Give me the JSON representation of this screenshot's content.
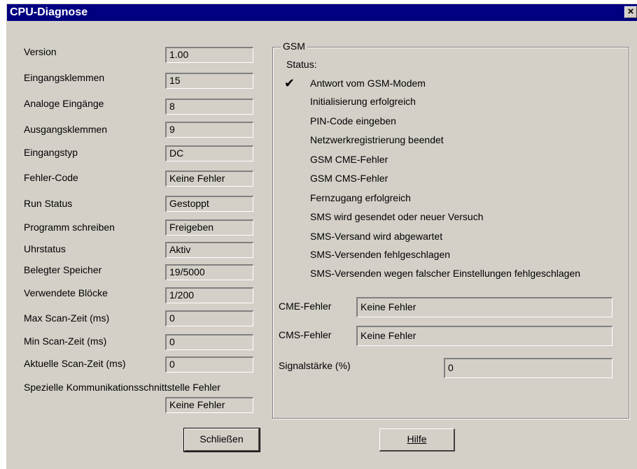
{
  "window": {
    "title": "CPU-Diagnose",
    "close_symbol": "×"
  },
  "left": {
    "rows": [
      {
        "label": "Version",
        "value": "1.00"
      },
      {
        "label": "Eingangsklemmen",
        "value": "15"
      },
      {
        "label": "Analoge Eingänge",
        "value": "8"
      },
      {
        "label": "Ausgangsklemmen",
        "value": "9"
      },
      {
        "label": "Eingangstyp",
        "value": "DC"
      },
      {
        "label": "Fehler-Code",
        "value": "Keine Fehler"
      },
      {
        "label": "Run Status",
        "value": "Gestoppt"
      },
      {
        "label": "Programm schreiben",
        "value": "Freigeben"
      },
      {
        "label": "Uhrstatus",
        "value": "Aktiv"
      },
      {
        "label": "Belegter Speicher",
        "value": "19/5000"
      },
      {
        "label": "Verwendete Blöcke",
        "value": "1/200"
      },
      {
        "label": "Max Scan-Zeit (ms)",
        "value": "0"
      },
      {
        "label": "Min Scan-Zeit (ms)",
        "value": "0"
      },
      {
        "label": "Aktuelle Scan-Zeit (ms)",
        "value": "0"
      }
    ],
    "special_label": "Spezielle Kommunikationsschnittstelle Fehler",
    "special_value": "Keine Fehler"
  },
  "gsm": {
    "title": "GSM",
    "status_label": "Status:",
    "check_symbol": "✔",
    "status_items": [
      "Antwort vom GSM-Modem",
      "Initialisierung erfolgreich",
      "PIN-Code eingeben",
      "Netzwerkregistrierung beendet",
      "GSM CME-Fehler",
      "GSM CMS-Fehler",
      "Fernzugang erfolgreich",
      "SMS wird gesendet oder neuer Versuch",
      "SMS-Versand wird abgewartet",
      "SMS-Versenden fehlgeschlagen",
      "SMS-Versenden wegen falscher Einstellungen fehlgeschlagen"
    ],
    "checked_item": "Antwort vom GSM-Modem",
    "cme_label": "CME-Fehler",
    "cme_value": "Keine Fehler",
    "cms_label": "CMS-Fehler",
    "cms_value": "Keine Fehler",
    "signal_label": "Signalstärke (%)",
    "signal_value": "0"
  },
  "buttons": {
    "close_label": "Schließen",
    "help_label": "Hilfe"
  }
}
